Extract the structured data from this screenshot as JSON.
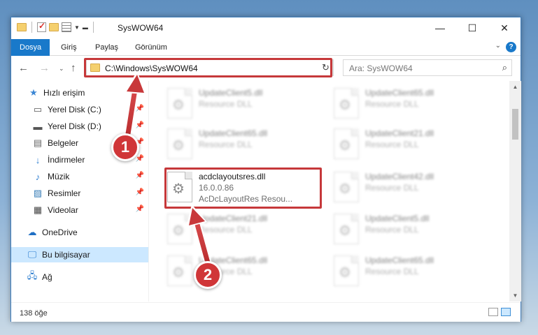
{
  "window": {
    "title": "SysWOW64"
  },
  "ribbon": {
    "tabs": [
      {
        "label": "Dosya",
        "active": true
      },
      {
        "label": "Giriş"
      },
      {
        "label": "Paylaş"
      },
      {
        "label": "Görünüm"
      }
    ]
  },
  "navbar": {
    "address": "C:\\Windows\\SysWOW64",
    "search_placeholder": "Ara: SysWOW64"
  },
  "sidebar": {
    "items": [
      {
        "label": "Hızlı erişim",
        "icon": "star-icon"
      },
      {
        "label": "Yerel Disk (C:)",
        "icon": "drive-icon",
        "pinned": true
      },
      {
        "label": "Yerel Disk (D:)",
        "icon": "drive-icon",
        "pinned": true
      },
      {
        "label": "Belgeler",
        "icon": "documents-icon",
        "pinned": true
      },
      {
        "label": "İndirmeler",
        "icon": "download-icon",
        "pinned": true
      },
      {
        "label": "Müzik",
        "icon": "music-icon",
        "pinned": true
      },
      {
        "label": "Resimler",
        "icon": "pictures-icon",
        "pinned": true
      },
      {
        "label": "Videolar",
        "icon": "video-icon",
        "pinned": true
      },
      {
        "label": "OneDrive",
        "icon": "cloud-icon"
      },
      {
        "label": "Bu bilgisayar",
        "icon": "computer-icon",
        "selected": true
      },
      {
        "label": "Ağ",
        "icon": "network-icon"
      }
    ]
  },
  "files": {
    "highlighted": {
      "name": "acdclayoutsres.dll",
      "version": "16.0.0.86",
      "description": "AcDcLayoutRes Resou..."
    },
    "blurred": [
      {
        "name": "UpdateClient5.dll",
        "type": "Resource DLL"
      },
      {
        "name": "UpdateClient65.dll",
        "type": "Resource DLL"
      },
      {
        "name": "UpdateClient65.dll",
        "type": "Resource DLL"
      },
      {
        "name": "UpdateClient21.dll",
        "type": "Resource DLL"
      },
      {
        "name": "UpdateClient42.dll",
        "type": "Resource DLL"
      },
      {
        "name": "UpdateClient21.dll",
        "type": "Resource DLL"
      },
      {
        "name": "UpdateClient5.dll",
        "type": "Resource DLL"
      },
      {
        "name": "UpdateClient65.dll",
        "type": "Resource DLL"
      },
      {
        "name": "UpdateClient65.dll",
        "type": "Resource DLL"
      }
    ]
  },
  "status": {
    "count": "138 öğe"
  },
  "callouts": {
    "one": "1",
    "two": "2",
    "color": "#d03638"
  }
}
